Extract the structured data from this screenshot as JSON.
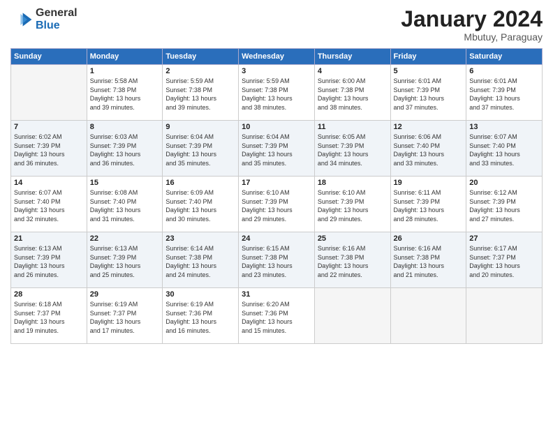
{
  "header": {
    "logo_general": "General",
    "logo_blue": "Blue",
    "month_year": "January 2024",
    "location": "Mbutuy, Paraguay"
  },
  "days_of_week": [
    "Sunday",
    "Monday",
    "Tuesday",
    "Wednesday",
    "Thursday",
    "Friday",
    "Saturday"
  ],
  "weeks": [
    [
      {
        "num": "",
        "info": ""
      },
      {
        "num": "1",
        "info": "Sunrise: 5:58 AM\nSunset: 7:38 PM\nDaylight: 13 hours\nand 39 minutes."
      },
      {
        "num": "2",
        "info": "Sunrise: 5:59 AM\nSunset: 7:38 PM\nDaylight: 13 hours\nand 39 minutes."
      },
      {
        "num": "3",
        "info": "Sunrise: 5:59 AM\nSunset: 7:38 PM\nDaylight: 13 hours\nand 38 minutes."
      },
      {
        "num": "4",
        "info": "Sunrise: 6:00 AM\nSunset: 7:38 PM\nDaylight: 13 hours\nand 38 minutes."
      },
      {
        "num": "5",
        "info": "Sunrise: 6:01 AM\nSunset: 7:39 PM\nDaylight: 13 hours\nand 37 minutes."
      },
      {
        "num": "6",
        "info": "Sunrise: 6:01 AM\nSunset: 7:39 PM\nDaylight: 13 hours\nand 37 minutes."
      }
    ],
    [
      {
        "num": "7",
        "info": "Sunrise: 6:02 AM\nSunset: 7:39 PM\nDaylight: 13 hours\nand 36 minutes."
      },
      {
        "num": "8",
        "info": "Sunrise: 6:03 AM\nSunset: 7:39 PM\nDaylight: 13 hours\nand 36 minutes."
      },
      {
        "num": "9",
        "info": "Sunrise: 6:04 AM\nSunset: 7:39 PM\nDaylight: 13 hours\nand 35 minutes."
      },
      {
        "num": "10",
        "info": "Sunrise: 6:04 AM\nSunset: 7:39 PM\nDaylight: 13 hours\nand 35 minutes."
      },
      {
        "num": "11",
        "info": "Sunrise: 6:05 AM\nSunset: 7:39 PM\nDaylight: 13 hours\nand 34 minutes."
      },
      {
        "num": "12",
        "info": "Sunrise: 6:06 AM\nSunset: 7:40 PM\nDaylight: 13 hours\nand 33 minutes."
      },
      {
        "num": "13",
        "info": "Sunrise: 6:07 AM\nSunset: 7:40 PM\nDaylight: 13 hours\nand 33 minutes."
      }
    ],
    [
      {
        "num": "14",
        "info": "Sunrise: 6:07 AM\nSunset: 7:40 PM\nDaylight: 13 hours\nand 32 minutes."
      },
      {
        "num": "15",
        "info": "Sunrise: 6:08 AM\nSunset: 7:40 PM\nDaylight: 13 hours\nand 31 minutes."
      },
      {
        "num": "16",
        "info": "Sunrise: 6:09 AM\nSunset: 7:40 PM\nDaylight: 13 hours\nand 30 minutes."
      },
      {
        "num": "17",
        "info": "Sunrise: 6:10 AM\nSunset: 7:39 PM\nDaylight: 13 hours\nand 29 minutes."
      },
      {
        "num": "18",
        "info": "Sunrise: 6:10 AM\nSunset: 7:39 PM\nDaylight: 13 hours\nand 29 minutes."
      },
      {
        "num": "19",
        "info": "Sunrise: 6:11 AM\nSunset: 7:39 PM\nDaylight: 13 hours\nand 28 minutes."
      },
      {
        "num": "20",
        "info": "Sunrise: 6:12 AM\nSunset: 7:39 PM\nDaylight: 13 hours\nand 27 minutes."
      }
    ],
    [
      {
        "num": "21",
        "info": "Sunrise: 6:13 AM\nSunset: 7:39 PM\nDaylight: 13 hours\nand 26 minutes."
      },
      {
        "num": "22",
        "info": "Sunrise: 6:13 AM\nSunset: 7:39 PM\nDaylight: 13 hours\nand 25 minutes."
      },
      {
        "num": "23",
        "info": "Sunrise: 6:14 AM\nSunset: 7:38 PM\nDaylight: 13 hours\nand 24 minutes."
      },
      {
        "num": "24",
        "info": "Sunrise: 6:15 AM\nSunset: 7:38 PM\nDaylight: 13 hours\nand 23 minutes."
      },
      {
        "num": "25",
        "info": "Sunrise: 6:16 AM\nSunset: 7:38 PM\nDaylight: 13 hours\nand 22 minutes."
      },
      {
        "num": "26",
        "info": "Sunrise: 6:16 AM\nSunset: 7:38 PM\nDaylight: 13 hours\nand 21 minutes."
      },
      {
        "num": "27",
        "info": "Sunrise: 6:17 AM\nSunset: 7:37 PM\nDaylight: 13 hours\nand 20 minutes."
      }
    ],
    [
      {
        "num": "28",
        "info": "Sunrise: 6:18 AM\nSunset: 7:37 PM\nDaylight: 13 hours\nand 19 minutes."
      },
      {
        "num": "29",
        "info": "Sunrise: 6:19 AM\nSunset: 7:37 PM\nDaylight: 13 hours\nand 17 minutes."
      },
      {
        "num": "30",
        "info": "Sunrise: 6:19 AM\nSunset: 7:36 PM\nDaylight: 13 hours\nand 16 minutes."
      },
      {
        "num": "31",
        "info": "Sunrise: 6:20 AM\nSunset: 7:36 PM\nDaylight: 13 hours\nand 15 minutes."
      },
      {
        "num": "",
        "info": ""
      },
      {
        "num": "",
        "info": ""
      },
      {
        "num": "",
        "info": ""
      }
    ]
  ]
}
